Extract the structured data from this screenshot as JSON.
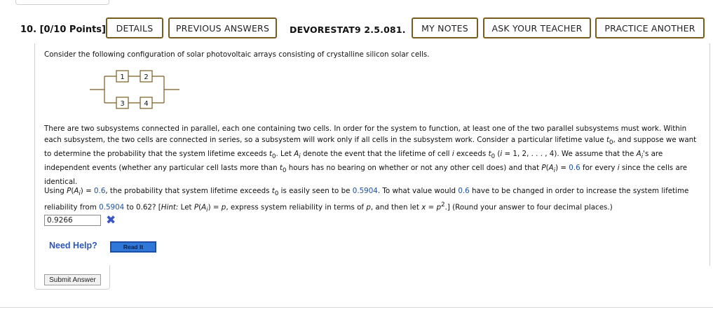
{
  "header": {
    "question_number": "10.",
    "points": "[0/10 Points]",
    "details_label": "DETAILS",
    "previous_answers_label": "PREVIOUS ANSWERS",
    "problem_code": "DEVORESTAT9 2.5.081.",
    "my_notes_label": "MY NOTES",
    "ask_teacher_label": "ASK YOUR TEACHER",
    "practice_another_label": "PRACTICE ANOTHER"
  },
  "question": {
    "intro": "Consider the following configuration of solar photovoltaic arrays consisting of crystalline silicon solar cells.",
    "diagram": {
      "cells": [
        "1",
        "2",
        "3",
        "4"
      ]
    },
    "para2": {
      "a": "There are two subsystems connected in parallel, each one containing two cells. In order for the system to function, at least one of the two parallel subsystems must work. Within each subsystem, the two cells are connected in series, so a subsystem will work only if all cells in the subsystem work. Consider a particular lifetime value ",
      "b": ", and suppose we want to determine the probability that the system lifetime exceeds ",
      "c": ". Let ",
      "d": " denote the event that the lifetime of cell ",
      "e": " exceeds ",
      "f": " (",
      "g": " = 1, 2, . . . , 4). We assume that the ",
      "h": "'s are independent events (whether any particular cell lasts more than ",
      "i": " hours has no bearing on whether or not any other cell does) and that ",
      "j": ") = ",
      "k": "0.6",
      "l": " for every ",
      "m": " since the cells are identical."
    },
    "para3": {
      "a": "Using ",
      "b": ") = ",
      "c": "0.6",
      "d": ", the probability that system lifetime exceeds ",
      "e": " is easily seen to be ",
      "f": "0.5904",
      "g": ". To what value would ",
      "h": "0.6",
      "i": " have to be changed in order to increase the system lifetime reliability from ",
      "j": "0.5904",
      "k": " to 0.62? [",
      "l": "Hint:",
      "m": " Let ",
      "n": ") = ",
      "o": ", express system reliability in terms of ",
      "p": ", and then let ",
      "q": " = ",
      "r": ".] (Round your answer to four decimal places.)"
    },
    "symbols": {
      "t": "t",
      "zero": "0",
      "A": "A",
      "i": "i",
      "P": "P",
      "p": "p",
      "x": "x",
      "two": "2"
    }
  },
  "answer": {
    "value": "0.9266",
    "status_icon": "✖",
    "status": "incorrect"
  },
  "help": {
    "label": "Need Help?",
    "read_it_label": "Read It"
  },
  "submit_label": "Submit Answer",
  "colors": {
    "button_border": "#7a5a1e",
    "highlight": "#1a4f9c",
    "help_blue": "#2a56b8",
    "wrong_mark": "#3a56c8"
  }
}
